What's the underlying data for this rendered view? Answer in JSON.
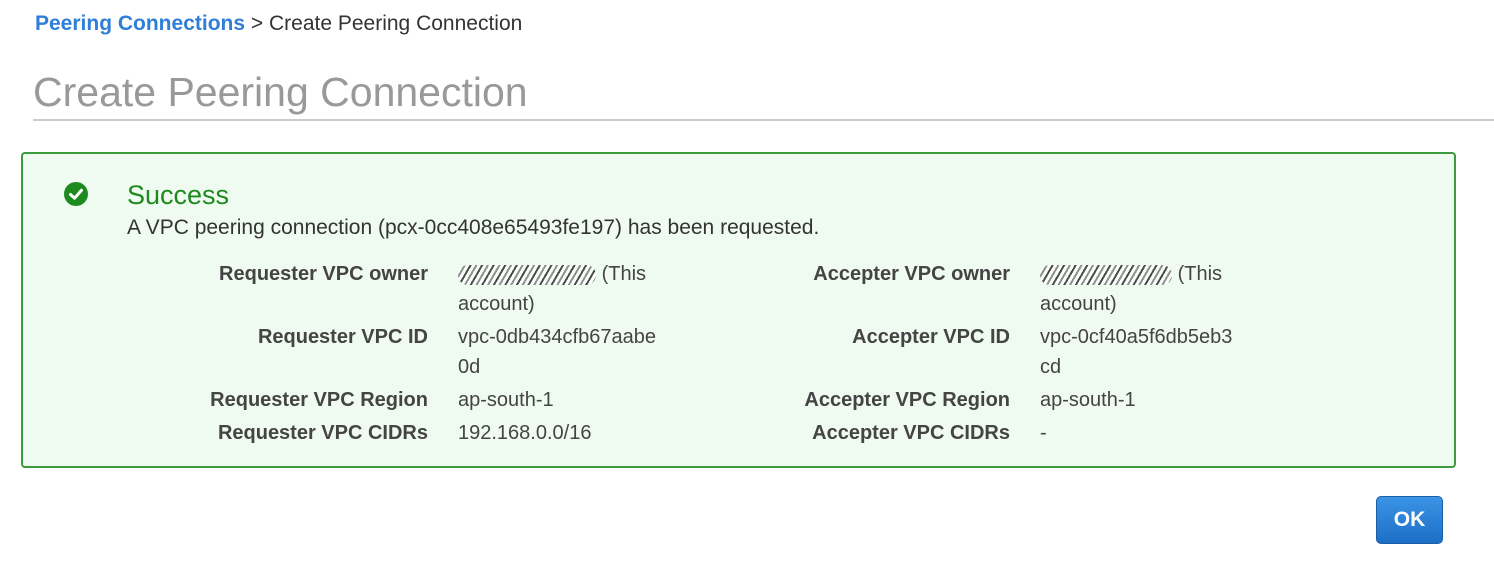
{
  "breadcrumb": {
    "parent_label": "Peering Connections",
    "separator": ">",
    "current_label": "Create Peering Connection"
  },
  "page_title": "Create Peering Connection",
  "alert": {
    "icon": "check-circle-icon",
    "title": "Success",
    "message": "A VPC peering connection (pcx-0cc408e65493fe197) has been requested.",
    "colors": {
      "border": "#3d9a3d",
      "background": "#effaf0",
      "title": "#1d8a1d"
    }
  },
  "requester": {
    "owner_label": "Requester VPC owner",
    "owner_suffix": "(This account)",
    "vpc_id_label": "Requester VPC ID",
    "vpc_id_value": "vpc-0db434cfb67aabe0d",
    "region_label": "Requester VPC Region",
    "region_value": "ap-south-1",
    "cidrs_label": "Requester VPC CIDRs",
    "cidrs_value": "192.168.0.0/16"
  },
  "accepter": {
    "owner_label": "Accepter VPC owner",
    "owner_suffix": "(This account)",
    "vpc_id_label": "Accepter VPC ID",
    "vpc_id_value": "vpc-0cf40a5f6db5eb3cd",
    "region_label": "Accepter VPC Region",
    "region_value": "ap-south-1",
    "cidrs_label": "Accepter VPC CIDRs",
    "cidrs_value": "-"
  },
  "ok_button_label": "OK",
  "colors": {
    "link": "#2f7ed8",
    "primary_button": "#1d6fc6"
  }
}
